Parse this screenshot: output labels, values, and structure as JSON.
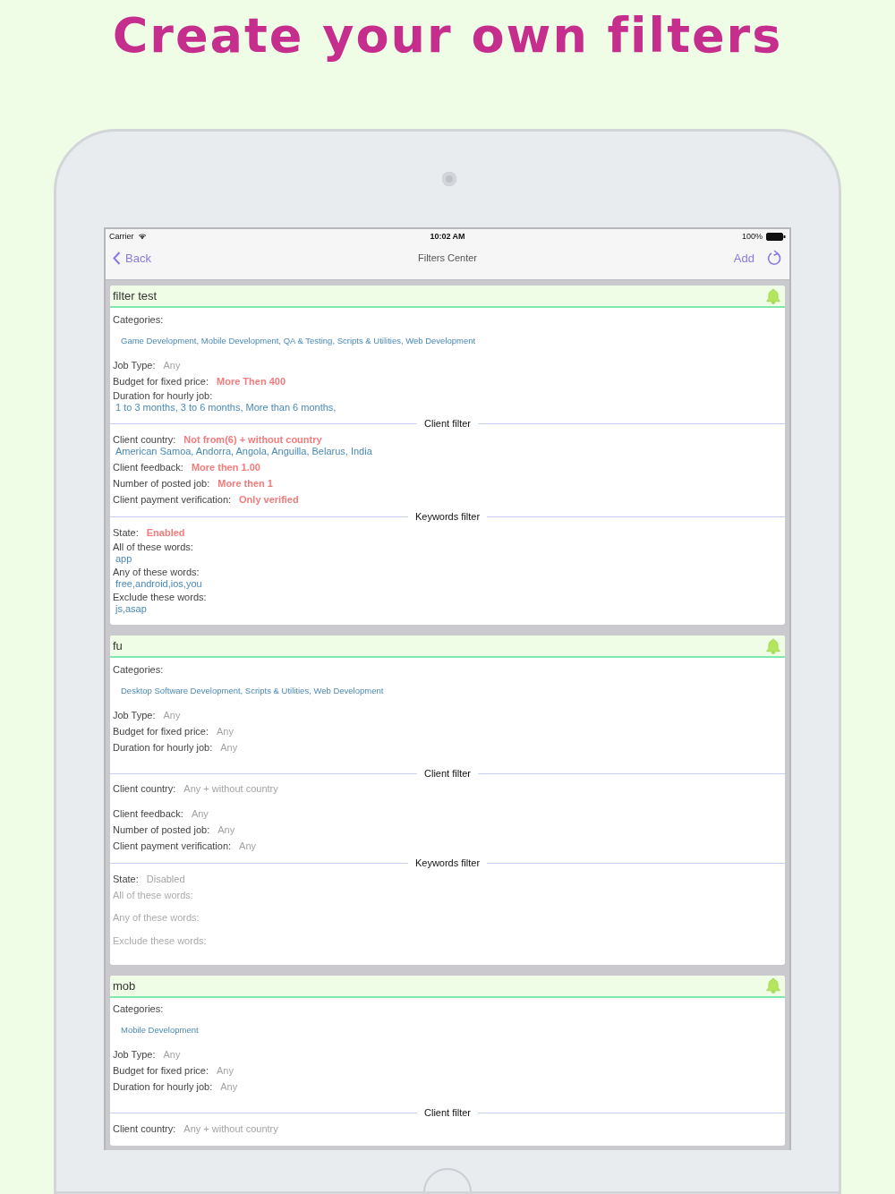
{
  "headline": "Create your own filters",
  "status_bar": {
    "carrier": "Carrier",
    "time": "10:02 AM",
    "battery": "100%"
  },
  "nav_bar": {
    "back": "Back",
    "title": "Filters Center",
    "add": "Add"
  },
  "filters": [
    {
      "name": "filter test",
      "rows": [
        {
          "kind": "categories",
          "label": "Categories:",
          "value": "Game Development, Mobile Development, QA & Testing, Scripts & Utilities, Web Development"
        },
        {
          "kind": "field",
          "label": "Job Type:",
          "value": "Any",
          "active": false
        },
        {
          "kind": "field",
          "label": "Budget for fixed price:",
          "value": "More Then 400",
          "active": true
        },
        {
          "kind": "stacked",
          "label": "Duration for hourly job:",
          "value": "1 to 3 months, 3 to 6 months, More than 6 months,"
        },
        {
          "kind": "section",
          "title": "Client filter"
        },
        {
          "kind": "field",
          "label": "Client country:",
          "value": "Not from(6) + without country",
          "active": true,
          "detail": "American Samoa, Andorra, Angola, Anguilla, Belarus, India"
        },
        {
          "kind": "field",
          "label": "Client feedback:",
          "value": "More then 1.00",
          "active": true
        },
        {
          "kind": "field",
          "label": "Number of posted job:",
          "value": "More then 1",
          "active": true
        },
        {
          "kind": "field",
          "label": "Client payment verification:",
          "value": "Only verified",
          "active": true
        },
        {
          "kind": "section",
          "title": "Keywords filter"
        },
        {
          "kind": "field",
          "label": "State:",
          "value": "Enabled",
          "active": true
        },
        {
          "kind": "stacked",
          "label": "All of these words:",
          "value": "app"
        },
        {
          "kind": "stacked",
          "label": "Any of these words:",
          "value": "free,android,ios,you"
        },
        {
          "kind": "stacked",
          "label": "Exclude these words:",
          "value": "js,asap"
        }
      ]
    },
    {
      "name": "fu",
      "rows": [
        {
          "kind": "categories",
          "label": "Categories:",
          "value": "Desktop Software Development, Scripts & Utilities, Web Development"
        },
        {
          "kind": "field",
          "label": "Job Type:",
          "value": "Any",
          "active": false
        },
        {
          "kind": "field",
          "label": "Budget for fixed price:",
          "value": "Any",
          "active": false
        },
        {
          "kind": "field",
          "label": "Duration for hourly job:",
          "value": "Any",
          "active": false,
          "gap": true
        },
        {
          "kind": "section",
          "title": "Client filter"
        },
        {
          "kind": "field",
          "label": "Client country:",
          "value": "Any + without country",
          "active": false,
          "gap": true
        },
        {
          "kind": "field",
          "label": "Client feedback:",
          "value": "Any",
          "active": false
        },
        {
          "kind": "field",
          "label": "Number of posted job:",
          "value": "Any",
          "active": false
        },
        {
          "kind": "field",
          "label": "Client payment verification:",
          "value": "Any",
          "active": false
        },
        {
          "kind": "section",
          "title": "Keywords filter"
        },
        {
          "kind": "field",
          "label": "State:",
          "value": "Disabled",
          "active": false
        },
        {
          "kind": "muted",
          "label": "All of these words:"
        },
        {
          "kind": "muted",
          "label": "Any of these words:"
        },
        {
          "kind": "muted",
          "label": "Exclude these words:"
        }
      ]
    },
    {
      "name": "mob",
      "rows": [
        {
          "kind": "categories",
          "label": "Categories:",
          "value": "Mobile Development"
        },
        {
          "kind": "field",
          "label": "Job Type:",
          "value": "Any",
          "active": false
        },
        {
          "kind": "field",
          "label": "Budget for fixed price:",
          "value": "Any",
          "active": false
        },
        {
          "kind": "field",
          "label": "Duration for hourly job:",
          "value": "Any",
          "active": false,
          "gap": true
        },
        {
          "kind": "section",
          "title": "Client filter"
        },
        {
          "kind": "field",
          "label": "Client country:",
          "value": "Any + without country",
          "active": false
        }
      ]
    }
  ]
}
